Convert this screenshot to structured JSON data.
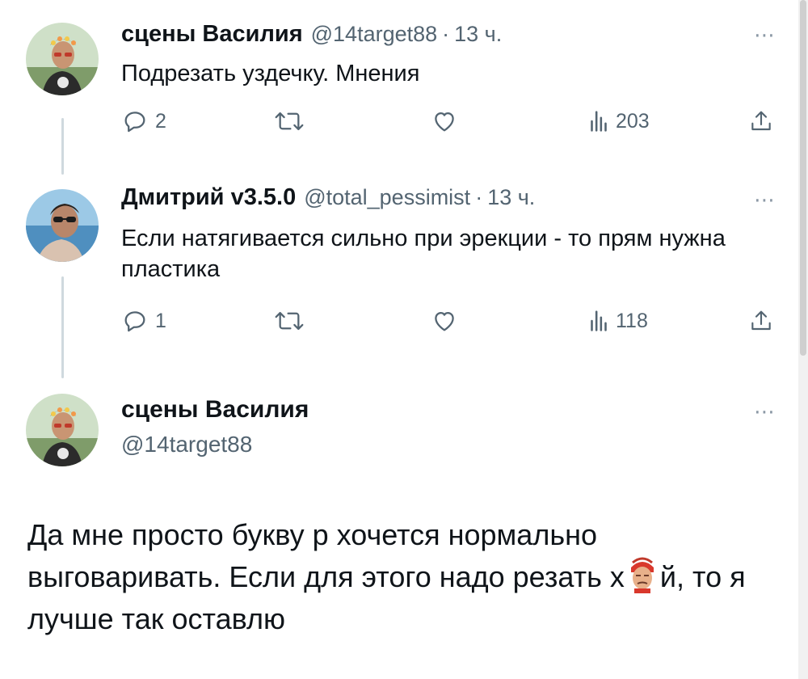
{
  "tweets": [
    {
      "author": "сцены Василия",
      "handle": "@14target88",
      "separator": "·",
      "time": "13 ч.",
      "text": "Подрезать уздечку. Мнения",
      "more_icon": "⋯",
      "replies": "2",
      "views": "203"
    },
    {
      "author": "Дмитрий v3.5.0",
      "handle": "@total_pessimist",
      "separator": "·",
      "time": "13 ч.",
      "text": "Если натягивается сильно при эрекции - то прям нужна пластика",
      "more_icon": "⋯",
      "replies": "1",
      "views": "118"
    }
  ],
  "main_tweet": {
    "author": "сцены Василия",
    "handle": "@14target88",
    "more_icon": "⋯",
    "text_before": "Да мне просто букву р хочется нормально выговаривать. Если для этого надо резать х",
    "text_after": "й, то я лучше так оставлю"
  },
  "icons": {
    "reply": "reply-icon",
    "retweet": "retweet-icon",
    "like": "heart-icon",
    "views": "views-icon",
    "share": "share-icon",
    "emoji": "censor-emoji-icon"
  },
  "colors": {
    "text": "#0f1419",
    "secondary": "#536471",
    "thread_line": "#cfd9de"
  }
}
